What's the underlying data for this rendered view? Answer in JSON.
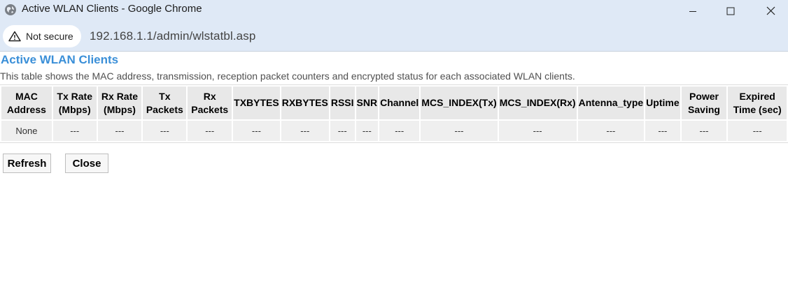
{
  "window": {
    "title": "Active WLAN Clients - Google Chrome",
    "icon": "globe-icon",
    "controls": [
      "minimize-icon",
      "maximize-icon",
      "close-icon"
    ]
  },
  "address_bar": {
    "security_label": "Not secure",
    "security_icon": "warning-icon",
    "url": "192.168.1.1/admin/wlstatbl.asp"
  },
  "page": {
    "title": "Active WLAN Clients",
    "description": "This table shows the MAC address, transmission, reception packet counters and encrypted status for each associated WLAN clients.",
    "table": {
      "headers": [
        "MAC\nAddress",
        "Tx Rate\n(Mbps)",
        "Rx Rate\n(Mbps)",
        "Tx\nPackets",
        "Rx\nPackets",
        "TXBYTES",
        "RXBYTES",
        "RSSI",
        "SNR",
        "Channel",
        "MCS_INDEX(Tx)",
        "MCS_INDEX(Rx)",
        "Antenna_type",
        "Uptime",
        "Power\nSaving",
        "Expired\nTime (sec)"
      ],
      "rows": [
        [
          "None",
          "---",
          "---",
          "---",
          "---",
          "---",
          "---",
          "---",
          "---",
          "---",
          "---",
          "---",
          "---",
          "---",
          "---",
          "---"
        ]
      ]
    },
    "buttons": {
      "refresh": "Refresh",
      "close": "Close"
    }
  },
  "colors": {
    "title_blue": "#3a8fd8",
    "chrome_frame": "#dfe9f6",
    "header_cell": "#e8e8e8",
    "data_cell": "#efefef"
  }
}
